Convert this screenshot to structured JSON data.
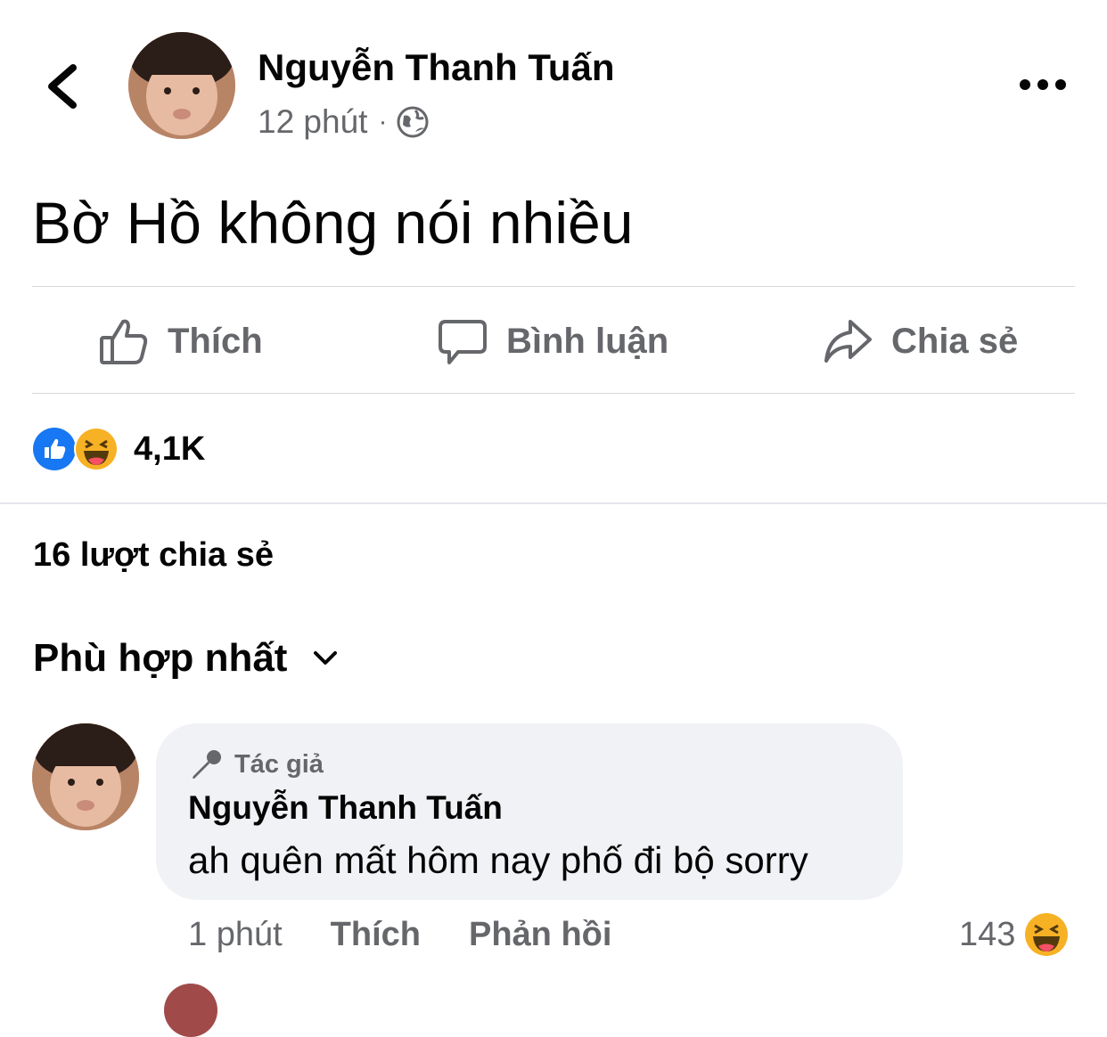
{
  "post": {
    "author_name": "Nguyễn Thanh Tuấn",
    "time": "12 phút",
    "separator": "·",
    "text": "Bờ Hồ không nói nhiều"
  },
  "actions": {
    "like": "Thích",
    "comment": "Bình luận",
    "share": "Chia sẻ"
  },
  "reactions": {
    "count": "4,1K",
    "types": [
      "like",
      "haha"
    ]
  },
  "shares": {
    "label": "16 lượt chia sẻ"
  },
  "sort": {
    "label": "Phù hợp nhất"
  },
  "comment": {
    "badge": "Tác giả",
    "author_name": "Nguyễn Thanh Tuấn",
    "text": "ah quên mất hôm nay phố đi bộ sorry",
    "time": "1 phút",
    "like": "Thích",
    "reply": "Phản hồi",
    "reaction_count": "143",
    "reaction_type": "haha"
  },
  "colors": {
    "secondary_text": "#65676b",
    "bubble": "#f0f2f5",
    "like_blue": "#1877f2",
    "haha_yellow": "#f7b125"
  }
}
